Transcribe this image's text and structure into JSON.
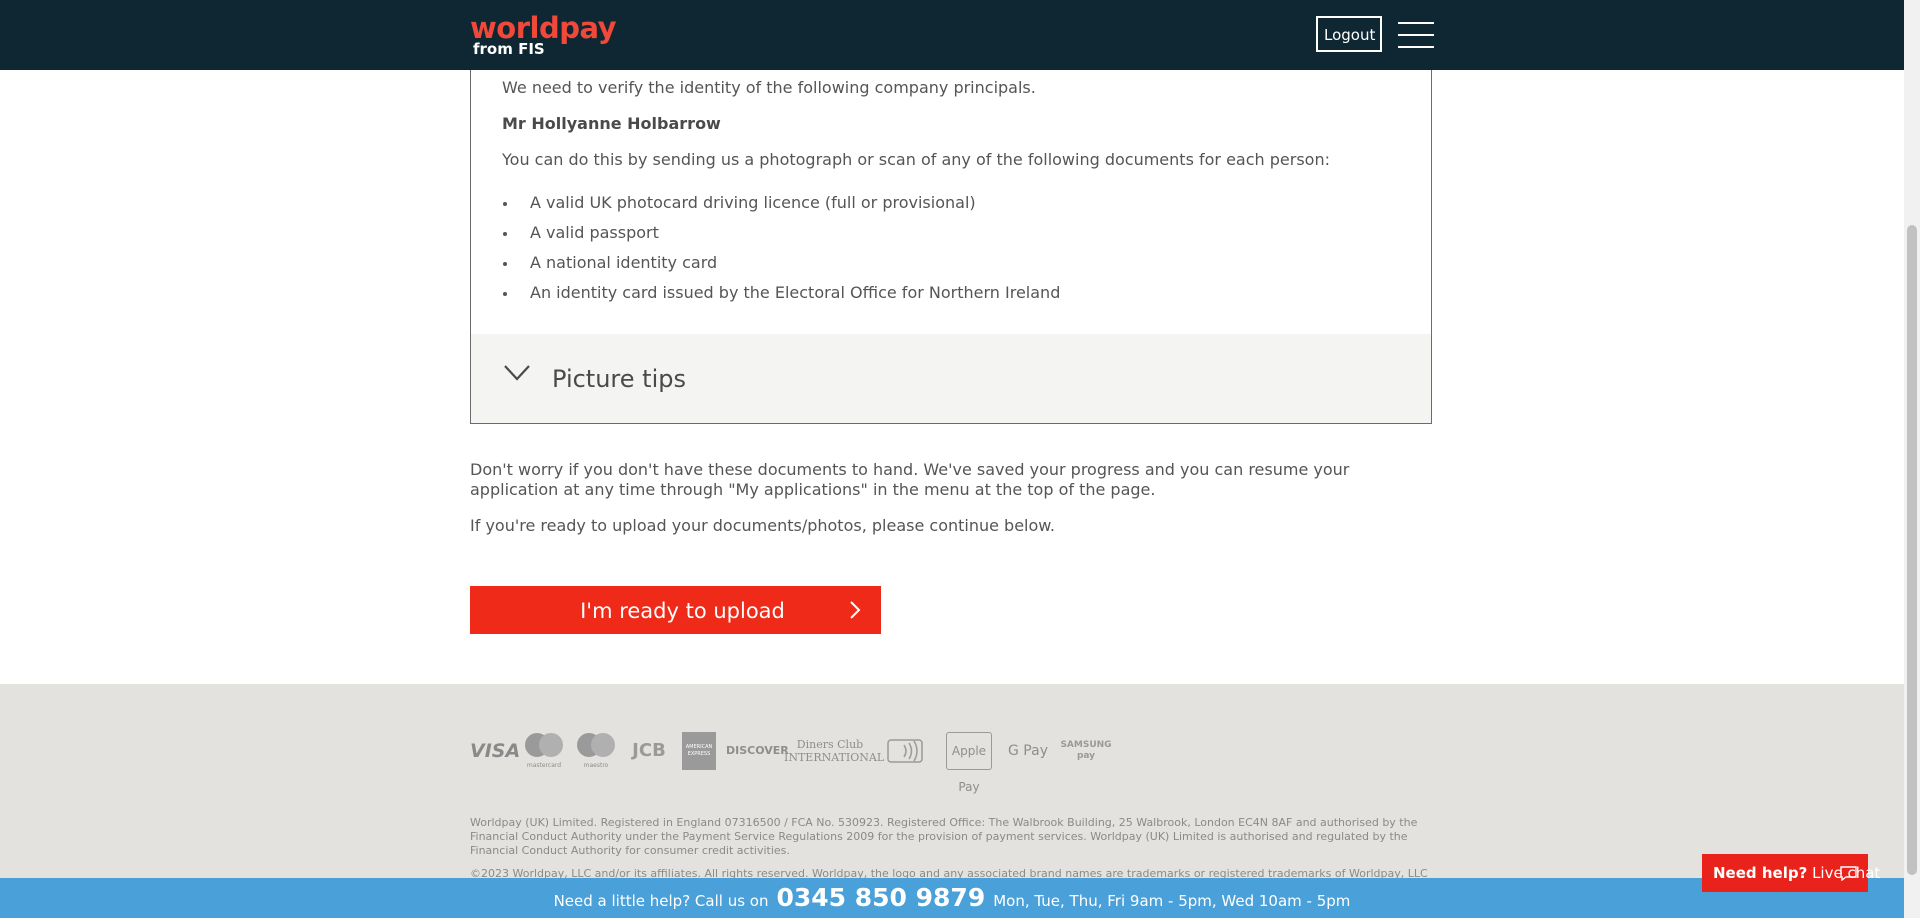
{
  "header": {
    "logo_word": "worldpay",
    "logo_sub": "from FIS",
    "logout_label": "Logout"
  },
  "panel": {
    "intro": "We need to verify the identity of the following company principals.",
    "principal_name": "Mr Hollyanne Holbarrow",
    "instruction": "You can do this by sending us a photograph or scan of any of the following documents for each person:",
    "documents": [
      "A valid UK photocard driving licence (full or provisional)",
      "A valid passport",
      "A national identity card",
      "An identity card issued by the Electoral Office for Northern Ireland"
    ],
    "tips_label": "Picture tips"
  },
  "main": {
    "resume_note": "Don't worry if you don't have these documents to hand. We've saved your progress and you can resume your application at any time through \"My applications\" in the menu at the top of the page.",
    "ready_note": "If you're ready to upload your documents/photos, please continue below.",
    "upload_button": "I'm ready to upload"
  },
  "footer": {
    "payment_methods": [
      "VISA",
      "mastercard",
      "maestro",
      "JCB",
      "AMERICAN EXPRESS",
      "DISCOVER",
      "Diners Club INTERNATIONAL",
      "contactless",
      "Apple Pay",
      "G Pay",
      "SAMSUNG pay"
    ],
    "legal_1": "Worldpay (UK) Limited. Registered in England 07316500 / FCA No. 530923. Registered Office: The Walbrook Building, 25 Walbrook, London EC4N 8AF and authorised by the Financial Conduct Authority under the Payment Service Regulations 2009 for the provision of payment services. Worldpay (UK) Limited is authorised and regulated by the Financial Conduct Authority for consumer credit activities.",
    "legal_2": "©2023 Worldpay, LLC and/or its affiliates. All rights reserved. Worldpay, the logo and any associated brand names are trademarks or registered trademarks of Worldpay, LLC"
  },
  "help_bar": {
    "prefix": "Need a little help? Call us on",
    "phone": "0345 850 9879",
    "hours": "Mon, Tue, Thu, Fri 9am - 5pm, Wed 10am - 5pm"
  },
  "live_chat": {
    "bold": "Need help?",
    "label": "Live chat"
  },
  "colors": {
    "header_bg": "#0f2733",
    "brand_red": "#f02a18",
    "logo_red": "#f0493a",
    "help_bar_bg": "#4aa0d8",
    "footer_bg": "#e4e2de"
  }
}
